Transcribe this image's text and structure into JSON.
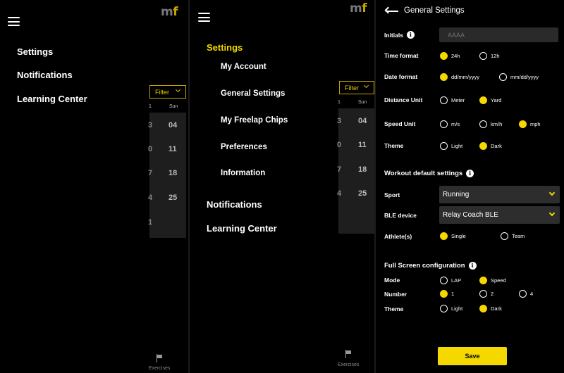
{
  "logo": {
    "m": "m",
    "f": "f"
  },
  "menu_closed": {
    "items": [
      "Settings",
      "Notifications",
      "Learning Center"
    ]
  },
  "menu_open": {
    "settings": "Settings",
    "sub_items": [
      "My Account",
      "General Settings",
      "My Freelap Chips",
      "Preferences",
      "Information"
    ],
    "notifications": "Notifications",
    "learning_center": "Learning Center"
  },
  "filter_label": "Filter",
  "calendar": {
    "header_left": "1",
    "header_day": "Sun",
    "dates": [
      "04",
      "11",
      "18",
      "25"
    ],
    "cut_digits": [
      "3",
      "0",
      "7",
      "4",
      "1"
    ]
  },
  "bottom_nav": {
    "exercises_label": "Exercises",
    "icon": "flag-icon"
  },
  "settings": {
    "title": "General Settings",
    "initials": {
      "label": "Initials",
      "placeholder": "AAAA"
    },
    "time_format": {
      "label": "Time format",
      "options": [
        "24h",
        "12h"
      ],
      "selected": "24h"
    },
    "date_format": {
      "label": "Date format",
      "options": [
        "dd/mm/yyyy",
        "mm/dd/yyyy"
      ],
      "selected": "dd/mm/yyyy"
    },
    "distance_unit": {
      "label": "Distance Unit",
      "options": [
        "Meter",
        "Yard"
      ],
      "selected": "Yard"
    },
    "speed_unit": {
      "label": "Speed Unit",
      "options": [
        "m/s",
        "km/h",
        "mph"
      ],
      "selected": "mph"
    },
    "theme": {
      "label": "Theme",
      "options": [
        "Light",
        "Dark"
      ],
      "selected": "Dark"
    },
    "workout_title": "Workout default settings",
    "sport": {
      "label": "Sport",
      "value": "Running"
    },
    "ble_device": {
      "label": "BLE device",
      "value": "Relay Coach BLE"
    },
    "athletes": {
      "label": "Athlete(s)",
      "options": [
        "Single",
        "Team"
      ],
      "selected": "Single"
    },
    "fullscreen_title": "Full Screen configuration",
    "mode": {
      "label": "Mode",
      "options": [
        "LAP",
        "Speed"
      ],
      "selected": "Speed"
    },
    "number": {
      "label": "Number",
      "options": [
        "1",
        "2",
        "4"
      ],
      "selected": "1"
    },
    "fs_theme": {
      "label": "Theme",
      "options": [
        "Light",
        "Dark"
      ],
      "selected": "Dark"
    },
    "save_label": "Save"
  },
  "colors": {
    "accent": "#f5d800",
    "background": "#000000",
    "field": "#2d2d2d"
  }
}
